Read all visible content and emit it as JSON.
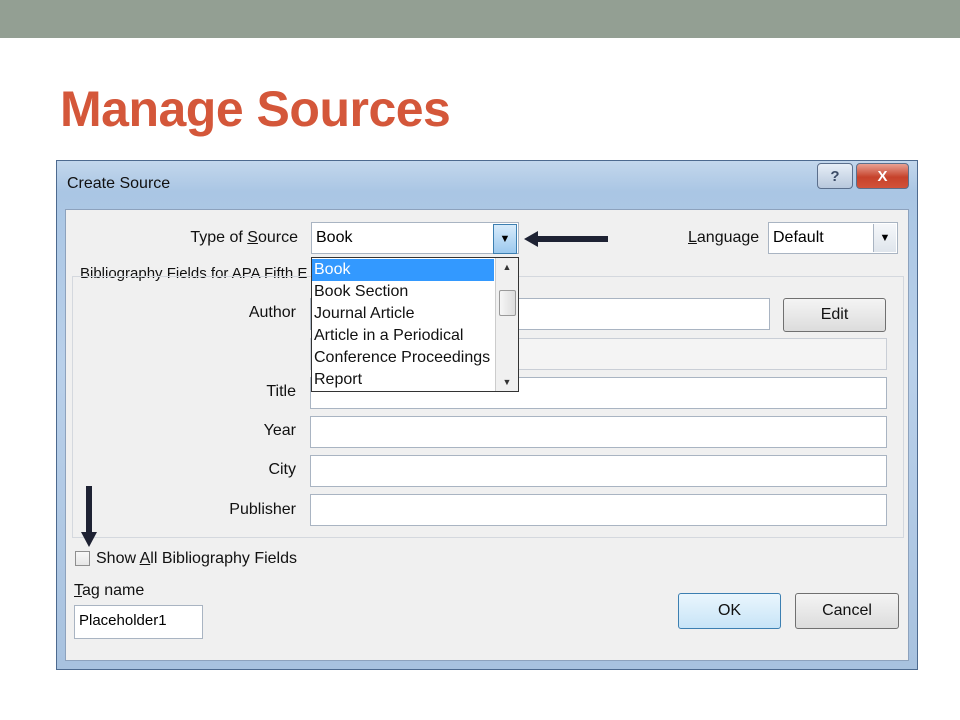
{
  "slide": {
    "title": "Manage Sources"
  },
  "dialog": {
    "title": "Create Source",
    "help_symbol": "?",
    "close_symbol": "X",
    "type_of_source": {
      "label_pre": "Type of ",
      "label_key": "S",
      "label_post": "ource",
      "value": "Book"
    },
    "language": {
      "label_key": "L",
      "label_post": "anguage",
      "value": "Default"
    },
    "group_label": "Bibliography Fields for APA Fifth E",
    "fields": [
      {
        "label": "Author",
        "value": ""
      },
      {
        "label": "Title",
        "value": ""
      },
      {
        "label": "Year",
        "value": ""
      },
      {
        "label": "City",
        "value": ""
      },
      {
        "label": "Publisher",
        "value": ""
      }
    ],
    "edit_button": "Edit",
    "dropdown_items": [
      "Book",
      "Book Section",
      "Journal Article",
      "Article in a Periodical",
      "Conference Proceedings",
      "Report"
    ],
    "show_all": {
      "pre": "Show ",
      "key": "A",
      "post": "ll Bibliography Fields",
      "checked": false
    },
    "tag_name": {
      "label_key": "T",
      "label_post": "ag name",
      "value": "Placeholder1"
    },
    "ok_button": "OK",
    "cancel_button": "Cancel"
  },
  "icons": {
    "dropdown_arrow": "chevron-down-icon",
    "annotation": "arrow-icon"
  },
  "colors": {
    "title": "#d4573a",
    "top_bar": "#939f93",
    "selection": "#3399ff"
  }
}
